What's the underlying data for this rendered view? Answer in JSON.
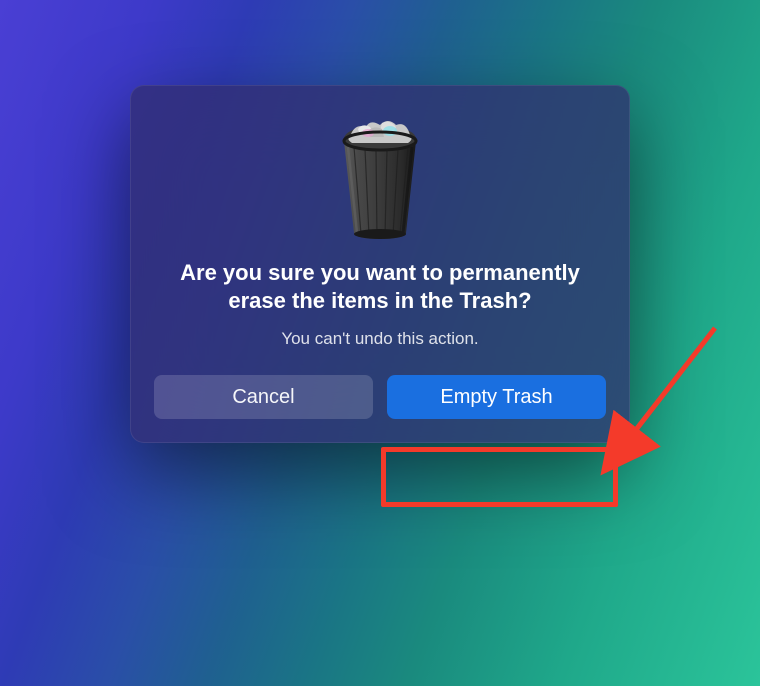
{
  "dialog": {
    "title": "Are you sure you want to permanently erase the items in the Trash?",
    "subtitle": "You can't undo this action.",
    "cancel_label": "Cancel",
    "confirm_label": "Empty Trash"
  },
  "icons": {
    "trash": "trash-full-icon"
  },
  "annotation": {
    "highlighted_button": "empty-trash-button",
    "arrow_color": "#f43a2a",
    "highlight_color": "#f43a2a"
  }
}
